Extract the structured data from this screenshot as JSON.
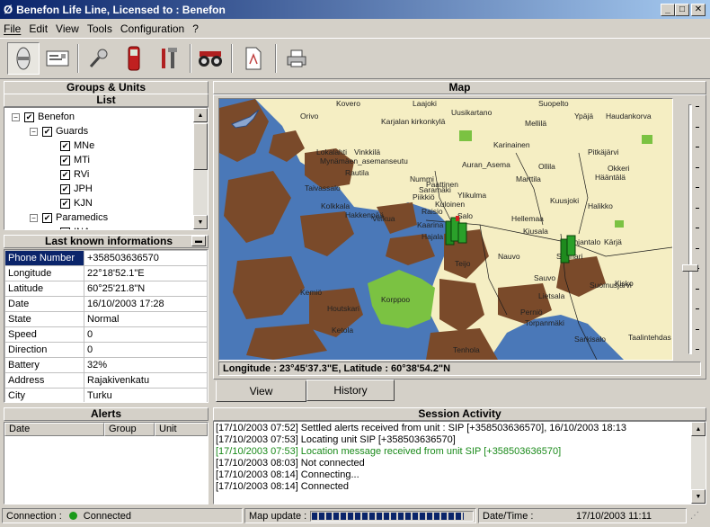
{
  "window": {
    "title": "Benefon Life Line, Licensed to : Benefon",
    "min_glyph": "_",
    "max_glyph": "□",
    "close_glyph": "✕"
  },
  "menu": [
    "File",
    "Edit",
    "View",
    "Tools",
    "Configuration",
    "?"
  ],
  "toolbar": {
    "icons": [
      "locate-icon",
      "card-icon",
      "key-icon",
      "phone-icon",
      "tools-icon",
      "binoculars-icon",
      "document-icon",
      "printer-icon"
    ]
  },
  "groups": {
    "header": "Groups & Units",
    "subheader": "List",
    "tree": [
      {
        "label": "Benefon",
        "level": 0,
        "expander": "−",
        "check": "✔"
      },
      {
        "label": "Guards",
        "level": 1,
        "expander": "−",
        "check": "✔"
      },
      {
        "label": "MNe",
        "level": 2,
        "check": "✔"
      },
      {
        "label": "MTi",
        "level": 2,
        "check": "✔"
      },
      {
        "label": "RVi",
        "level": 2,
        "check": "✔"
      },
      {
        "label": "JPH",
        "level": 2,
        "check": "✔"
      },
      {
        "label": "KJN",
        "level": 2,
        "check": "✔"
      },
      {
        "label": "Paramedics",
        "level": 1,
        "expander": "−",
        "check": "✔"
      },
      {
        "label": "INA",
        "level": 2,
        "check": "✔"
      }
    ]
  },
  "last_known": {
    "header": "Last known informations",
    "rows": [
      {
        "key": "Phone Number",
        "value": "+358503636570"
      },
      {
        "key": "Longitude",
        "value": "22°18'52.1\"E"
      },
      {
        "key": "Latitude",
        "value": "60°25'21.8\"N"
      },
      {
        "key": "Date",
        "value": "16/10/2003 17:28"
      },
      {
        "key": "State",
        "value": "Normal"
      },
      {
        "key": "Speed",
        "value": "0"
      },
      {
        "key": "Direction",
        "value": "0"
      },
      {
        "key": "Battery",
        "value": "32%"
      },
      {
        "key": "Address",
        "value": "Rajakivenkatu"
      },
      {
        "key": "City",
        "value": "Turku"
      }
    ]
  },
  "alerts": {
    "header": "Alerts",
    "columns": [
      "Date",
      "Group",
      "Unit"
    ]
  },
  "map": {
    "header": "Map",
    "coords_text": "Longitude : 23°45'37.3\"E, Latitude : 60°38'54.2\"N",
    "tabs": [
      "View",
      "History"
    ],
    "active_tab": "View",
    "zoom_level": 0.2,
    "land_color": "#f5eec3",
    "water_color": "#4a78b8",
    "forest_color": "#7bc242",
    "rock_color": "#7a4a2a",
    "places": [
      "Kovero",
      "Laajoki",
      "Suopelto",
      "Orivo",
      "Karjalan kirkonkylä",
      "Uusikartano",
      "Mellilä",
      "Ypäjä",
      "Haudankorva",
      "Lokalahti",
      "Vinkkilä",
      "Mynämäen_asemanseutu",
      "Karinainen",
      "Pitkäjärvi",
      "Rautila",
      "Auran_Asema",
      "Okkeri",
      "Nummi",
      "Marttila",
      "Ollila",
      "Taivassalo",
      "Ylikulma",
      "Hääntälä",
      "Piikkiö",
      "Paattinen",
      "Saramäki",
      "Kuusjoki",
      "Halikko",
      "Kolkkala",
      "Hakkenpää",
      "Velkua",
      "Hellemaa",
      "Kiusala",
      "Hajala",
      "Kaarina",
      "Perniö",
      "Kemiö",
      "Houtskari",
      "Korppoo",
      "Nauvo",
      "Sauvo",
      "Teijo",
      "Lietsala",
      "Torpanmäki",
      "Sarkisalo",
      "Tenhola",
      "Taalintehdas",
      "Kärjä",
      "Suomusjärvi",
      "Kisko",
      "Lohjantalo",
      "Sunnari",
      "Salo",
      "Raisio",
      "Kuloinen",
      "Ketola"
    ]
  },
  "session": {
    "header": "Session Activity",
    "lines": [
      {
        "text": "[17/10/2003 07:52] Settled alerts received from unit : SIP [+358503636570], 16/10/2003 18:13",
        "color": "#000000"
      },
      {
        "text": "[17/10/2003 07:53] Locating unit SIP [+358503636570]",
        "color": "#000000"
      },
      {
        "text": "[17/10/2003 07:53] Location message received from unit SIP [+358503636570]",
        "color": "#1a8a1a"
      },
      {
        "text": "[17/10/2003 08:03] Not connected",
        "color": "#000000"
      },
      {
        "text": "[17/10/2003 08:14] Connecting...",
        "color": "#000000"
      },
      {
        "text": "[17/10/2003 08:14] Connected",
        "color": "#000000"
      }
    ]
  },
  "status": {
    "connection_label": "Connection :",
    "connection_value": "Connected",
    "connection_color": "#1a9a1a",
    "map_update_label": "Map update :",
    "map_update_progress": 0.95,
    "datetime_label": "Date/Time :",
    "datetime_value": "17/10/2003 11:11"
  }
}
